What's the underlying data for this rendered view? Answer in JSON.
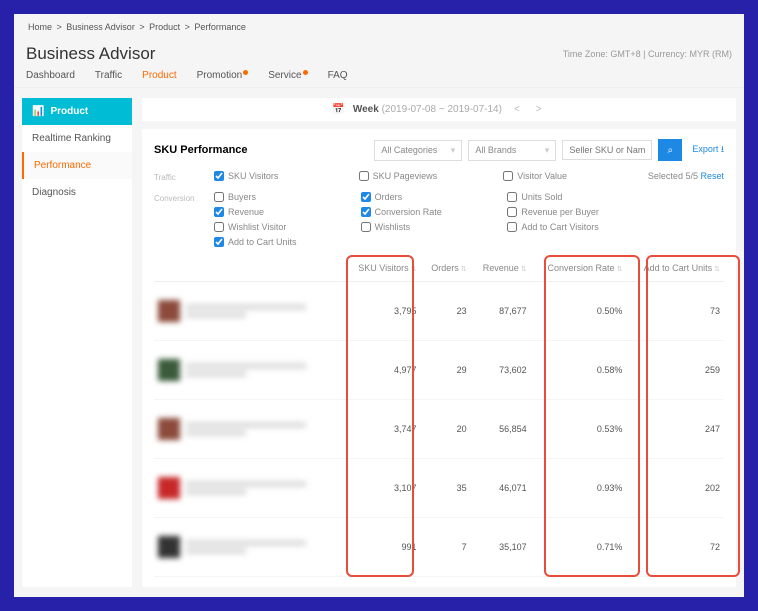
{
  "breadcrumb": [
    "Home",
    "Business Advisor",
    "Product",
    "Performance"
  ],
  "pageTitle": "Business Advisor",
  "timezone": "Time Zone: GMT+8 | Currency: MYR (RM)",
  "tabs": [
    {
      "label": "Dashboard",
      "dot": false,
      "active": false
    },
    {
      "label": "Traffic",
      "dot": false,
      "active": false
    },
    {
      "label": "Product",
      "dot": false,
      "active": true
    },
    {
      "label": "Promotion",
      "dot": true,
      "active": false
    },
    {
      "label": "Service",
      "dot": true,
      "active": false
    },
    {
      "label": "FAQ",
      "dot": false,
      "active": false
    }
  ],
  "sidebar": {
    "header": "Product",
    "items": [
      {
        "label": "Realtime Ranking",
        "active": false
      },
      {
        "label": "Performance",
        "active": true
      },
      {
        "label": "Diagnosis",
        "active": false
      }
    ]
  },
  "datebar": {
    "period": "Week",
    "range": "(2019-07-08 ~ 2019-07-14)"
  },
  "panel": {
    "title": "SKU Performance",
    "cat": "All Categories",
    "brand": "All Brands",
    "searchPh": "Seller SKU or Name",
    "export": "Export"
  },
  "metrics": {
    "traffic": {
      "label": "Traffic",
      "cols": [
        [
          {
            "label": "SKU Visitors",
            "checked": true
          }
        ],
        [
          {
            "label": "SKU Pageviews",
            "checked": false
          }
        ],
        [
          {
            "label": "Visitor Value",
            "checked": false
          }
        ]
      ]
    },
    "conversion": {
      "label": "Conversion",
      "cols": [
        [
          {
            "label": "Buyers",
            "checked": false
          },
          {
            "label": "Revenue",
            "checked": true
          },
          {
            "label": "Wishlist Visitor",
            "checked": false
          },
          {
            "label": "Add to Cart Units",
            "checked": true
          }
        ],
        [
          {
            "label": "Orders",
            "checked": true
          },
          {
            "label": "Conversion Rate",
            "checked": true
          },
          {
            "label": "Wishlists",
            "checked": false
          }
        ],
        [
          {
            "label": "Units Sold",
            "checked": false
          },
          {
            "label": "Revenue per Buyer",
            "checked": false
          },
          {
            "label": "Add to Cart Visitors",
            "checked": false
          }
        ]
      ]
    },
    "selected": "Selected 5/5",
    "reset": "Reset"
  },
  "columns": [
    "SKU Visitors",
    "Orders",
    "Revenue",
    "Conversion Rate",
    "Add to Cart Units"
  ],
  "rows": [
    {
      "sku_visitors": "3,795",
      "orders": "23",
      "revenue": "87,677",
      "conversion": "0.50%",
      "atc": "73"
    },
    {
      "sku_visitors": "4,977",
      "orders": "29",
      "revenue": "73,602",
      "conversion": "0.58%",
      "atc": "259"
    },
    {
      "sku_visitors": "3,747",
      "orders": "20",
      "revenue": "56,854",
      "conversion": "0.53%",
      "atc": "247"
    },
    {
      "sku_visitors": "3,107",
      "orders": "35",
      "revenue": "46,071",
      "conversion": "0.93%",
      "atc": "202"
    },
    {
      "sku_visitors": "991",
      "orders": "7",
      "revenue": "35,107",
      "conversion": "0.71%",
      "atc": "72"
    }
  ]
}
